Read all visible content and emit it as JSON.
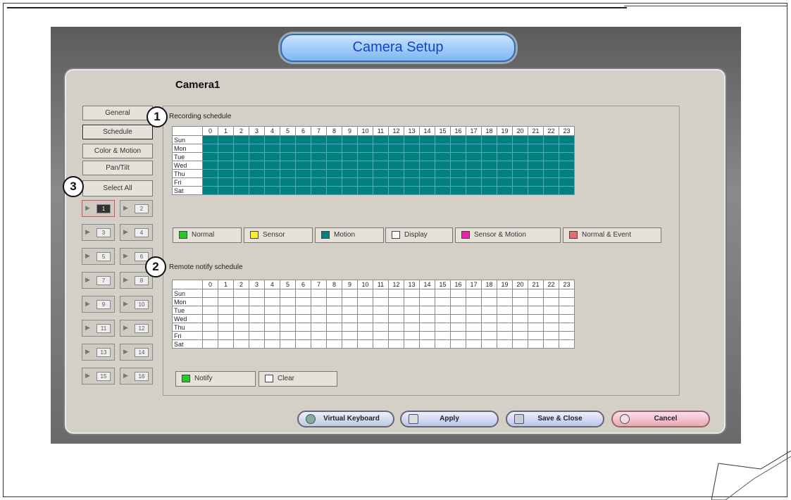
{
  "window": {
    "title": "Camera Setup",
    "camera_name": "Camera1"
  },
  "callouts": [
    "1",
    "2",
    "3"
  ],
  "sidebar": {
    "tabs": [
      {
        "label": "General",
        "selected": false
      },
      {
        "label": "Schedule",
        "selected": true
      },
      {
        "label": "Color & Motion",
        "selected": false
      },
      {
        "label": "Pan/Tilt",
        "selected": false
      }
    ],
    "select_all": "Select All",
    "cameras": [
      "1",
      "2",
      "3",
      "4",
      "5",
      "6",
      "7",
      "8",
      "9",
      "10",
      "11",
      "12",
      "13",
      "14",
      "15",
      "16"
    ],
    "active_camera": "1"
  },
  "recording": {
    "title": "Recording schedule",
    "hours": [
      "0",
      "1",
      "2",
      "3",
      "4",
      "5",
      "6",
      "7",
      "8",
      "9",
      "10",
      "11",
      "12",
      "13",
      "14",
      "15",
      "16",
      "17",
      "18",
      "19",
      "20",
      "21",
      "22",
      "23"
    ],
    "days": [
      "Sun",
      "Mon",
      "Tue",
      "Wed",
      "Thu",
      "Fri",
      "Sat"
    ],
    "fill_mode": "Motion",
    "legend": [
      {
        "label": "Normal",
        "color": "#22cc22"
      },
      {
        "label": "Sensor",
        "color": "#ffee22"
      },
      {
        "label": "Motion",
        "color": "#008080"
      },
      {
        "label": "Display",
        "color": "#ffffff"
      },
      {
        "label": "Sensor & Motion",
        "color": "#ee22aa"
      },
      {
        "label": "Normal & Event",
        "color": "#ee6a6a"
      }
    ]
  },
  "notify": {
    "title": "Remote notify schedule",
    "hours": [
      "0",
      "1",
      "2",
      "3",
      "4",
      "5",
      "6",
      "7",
      "8",
      "9",
      "10",
      "11",
      "12",
      "13",
      "14",
      "15",
      "16",
      "17",
      "18",
      "19",
      "20",
      "21",
      "22",
      "23"
    ],
    "days": [
      "Sun",
      "Mon",
      "Tue",
      "Wed",
      "Thu",
      "Fri",
      "Sat"
    ],
    "legend": [
      {
        "label": "Notify",
        "color": "#22cc22"
      },
      {
        "label": "Clear",
        "color": "#ffffff"
      }
    ]
  },
  "buttons": {
    "keyboard": "Virtual Keyboard",
    "apply": "Apply",
    "save_close": "Save & Close",
    "cancel": "Cancel"
  }
}
